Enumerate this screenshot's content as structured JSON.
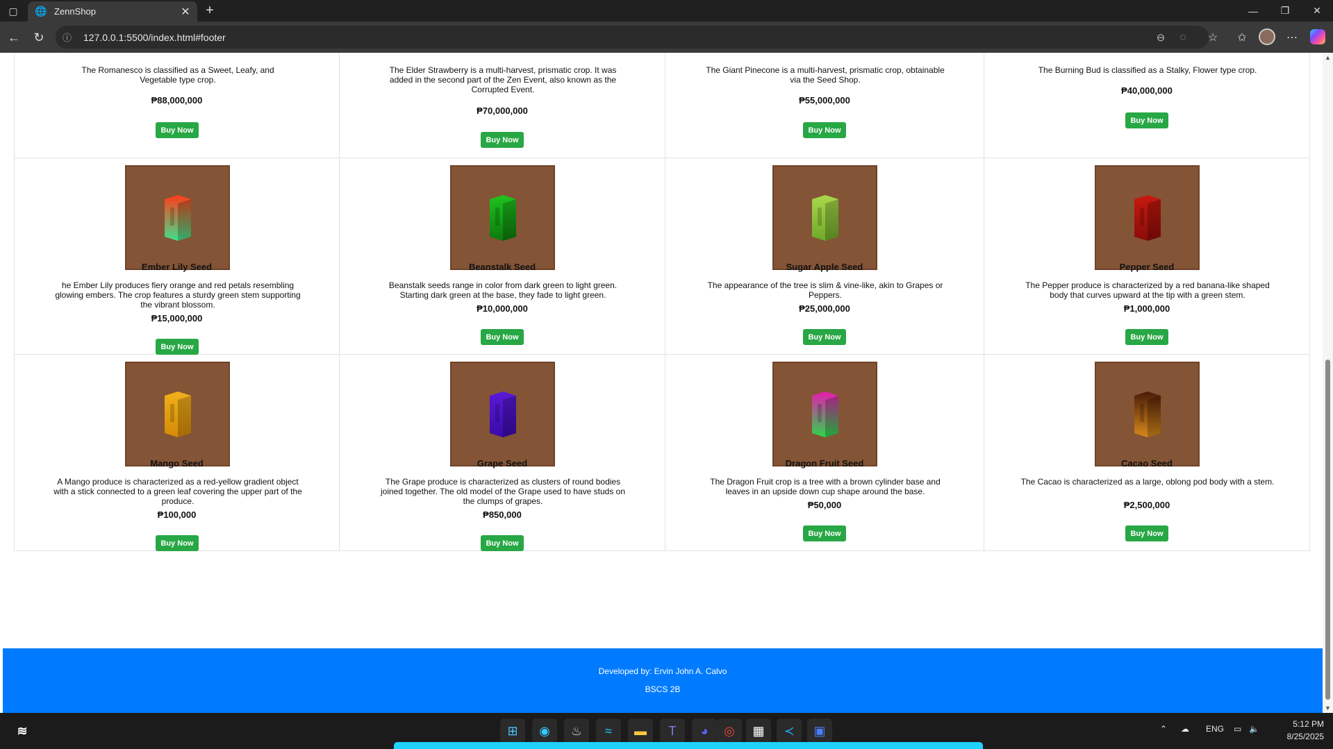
{
  "browser": {
    "tab_title": "ZennShop",
    "url": "127.0.0.1:5500/index.html#footer"
  },
  "top_row": [
    {
      "desc": "The Romanesco is classified as a Sweet, Leafy, and Vegetable type crop.",
      "price": "₱88,000,000",
      "button": "Buy Now"
    },
    {
      "desc": "The Elder Strawberry is a multi-harvest, prismatic crop. It was added in the second part of the Zen Event, also known as the Corrupted Event.",
      "price": "₱70,000,000",
      "button": "Buy Now"
    },
    {
      "desc": "The Giant Pinecone is a multi-harvest, prismatic crop, obtainable via the Seed Shop.",
      "price": "₱55,000,000",
      "button": "Buy Now"
    },
    {
      "desc": "The Burning Bud is classified as a Stalky, Flower type crop.",
      "price": "₱40,000,000",
      "button": "Buy Now"
    }
  ],
  "products": [
    {
      "name": "Ember Lily Seed",
      "desc": "he Ember Lily produces fiery orange and red petals resembling glowing embers. The crop features a sturdy green stem supporting the vibrant blossom.",
      "price": "₱15,000,000",
      "button": "Buy Now",
      "color_top": "#ff3b1a",
      "color_bottom": "#3fe08a"
    },
    {
      "name": "Beanstalk Seed",
      "desc": "Beanstalk seeds range in color from dark green to light green. Starting dark green at the base, they fade to light green.",
      "price": "₱10,000,000",
      "button": "Buy Now",
      "color_top": "#1fc41f",
      "color_bottom": "#0b7a0b"
    },
    {
      "name": "Sugar Apple Seed",
      "desc": "The appearance of the tree is slim & vine-like, akin to Grapes or Peppers.",
      "price": "₱25,000,000",
      "button": "Buy Now",
      "color_top": "#a9d84a",
      "color_bottom": "#6fa82a"
    },
    {
      "name": "Pepper Seed",
      "desc": "The Pepper produce is characterized by a red banana-like shaped body that curves upward at the tip with a green stem.",
      "price": "₱1,000,000",
      "button": "Buy Now",
      "color_top": "#c81a10",
      "color_bottom": "#8a0c08"
    },
    {
      "name": "Mango Seed",
      "desc": "A Mango produce is characterized as a red-yellow gradient object with a stick connected to a green leaf covering the upper part of the produce.",
      "price": "₱100,000",
      "button": "Buy Now",
      "color_top": "#f2b01a",
      "color_bottom": "#d48a08"
    },
    {
      "name": "Grape Seed",
      "desc": "The Grape produce is characterized as clusters of round bodies joined together. The old model of the Grape used to have studs on the clumps of grapes.",
      "price": "₱850,000",
      "button": "Buy Now",
      "color_top": "#5a1ad8",
      "color_bottom": "#3a0aa8"
    },
    {
      "name": "Dragon Fruit Seed",
      "desc": "The Dragon Fruit crop is a tree with a brown cylinder base and leaves in an upside down cup shape around the base.",
      "price": "₱50,000",
      "button": "Buy Now",
      "color_top": "#e81ab0",
      "color_bottom": "#2ad84a"
    },
    {
      "name": "Cacao Seed",
      "desc": "The Cacao is characterized as a large, oblong pod body with a stem.",
      "price": "₱2,500,000",
      "button": "Buy Now",
      "color_top": "#4a1a0a",
      "color_bottom": "#d88a1a"
    }
  ],
  "footer": {
    "developer": "Developed by: Ervin John A. Calvo",
    "section": "BSCS 2B"
  },
  "taskbar": {
    "language": "ENG",
    "time": "5:12 PM",
    "date": "8/25/2025"
  }
}
